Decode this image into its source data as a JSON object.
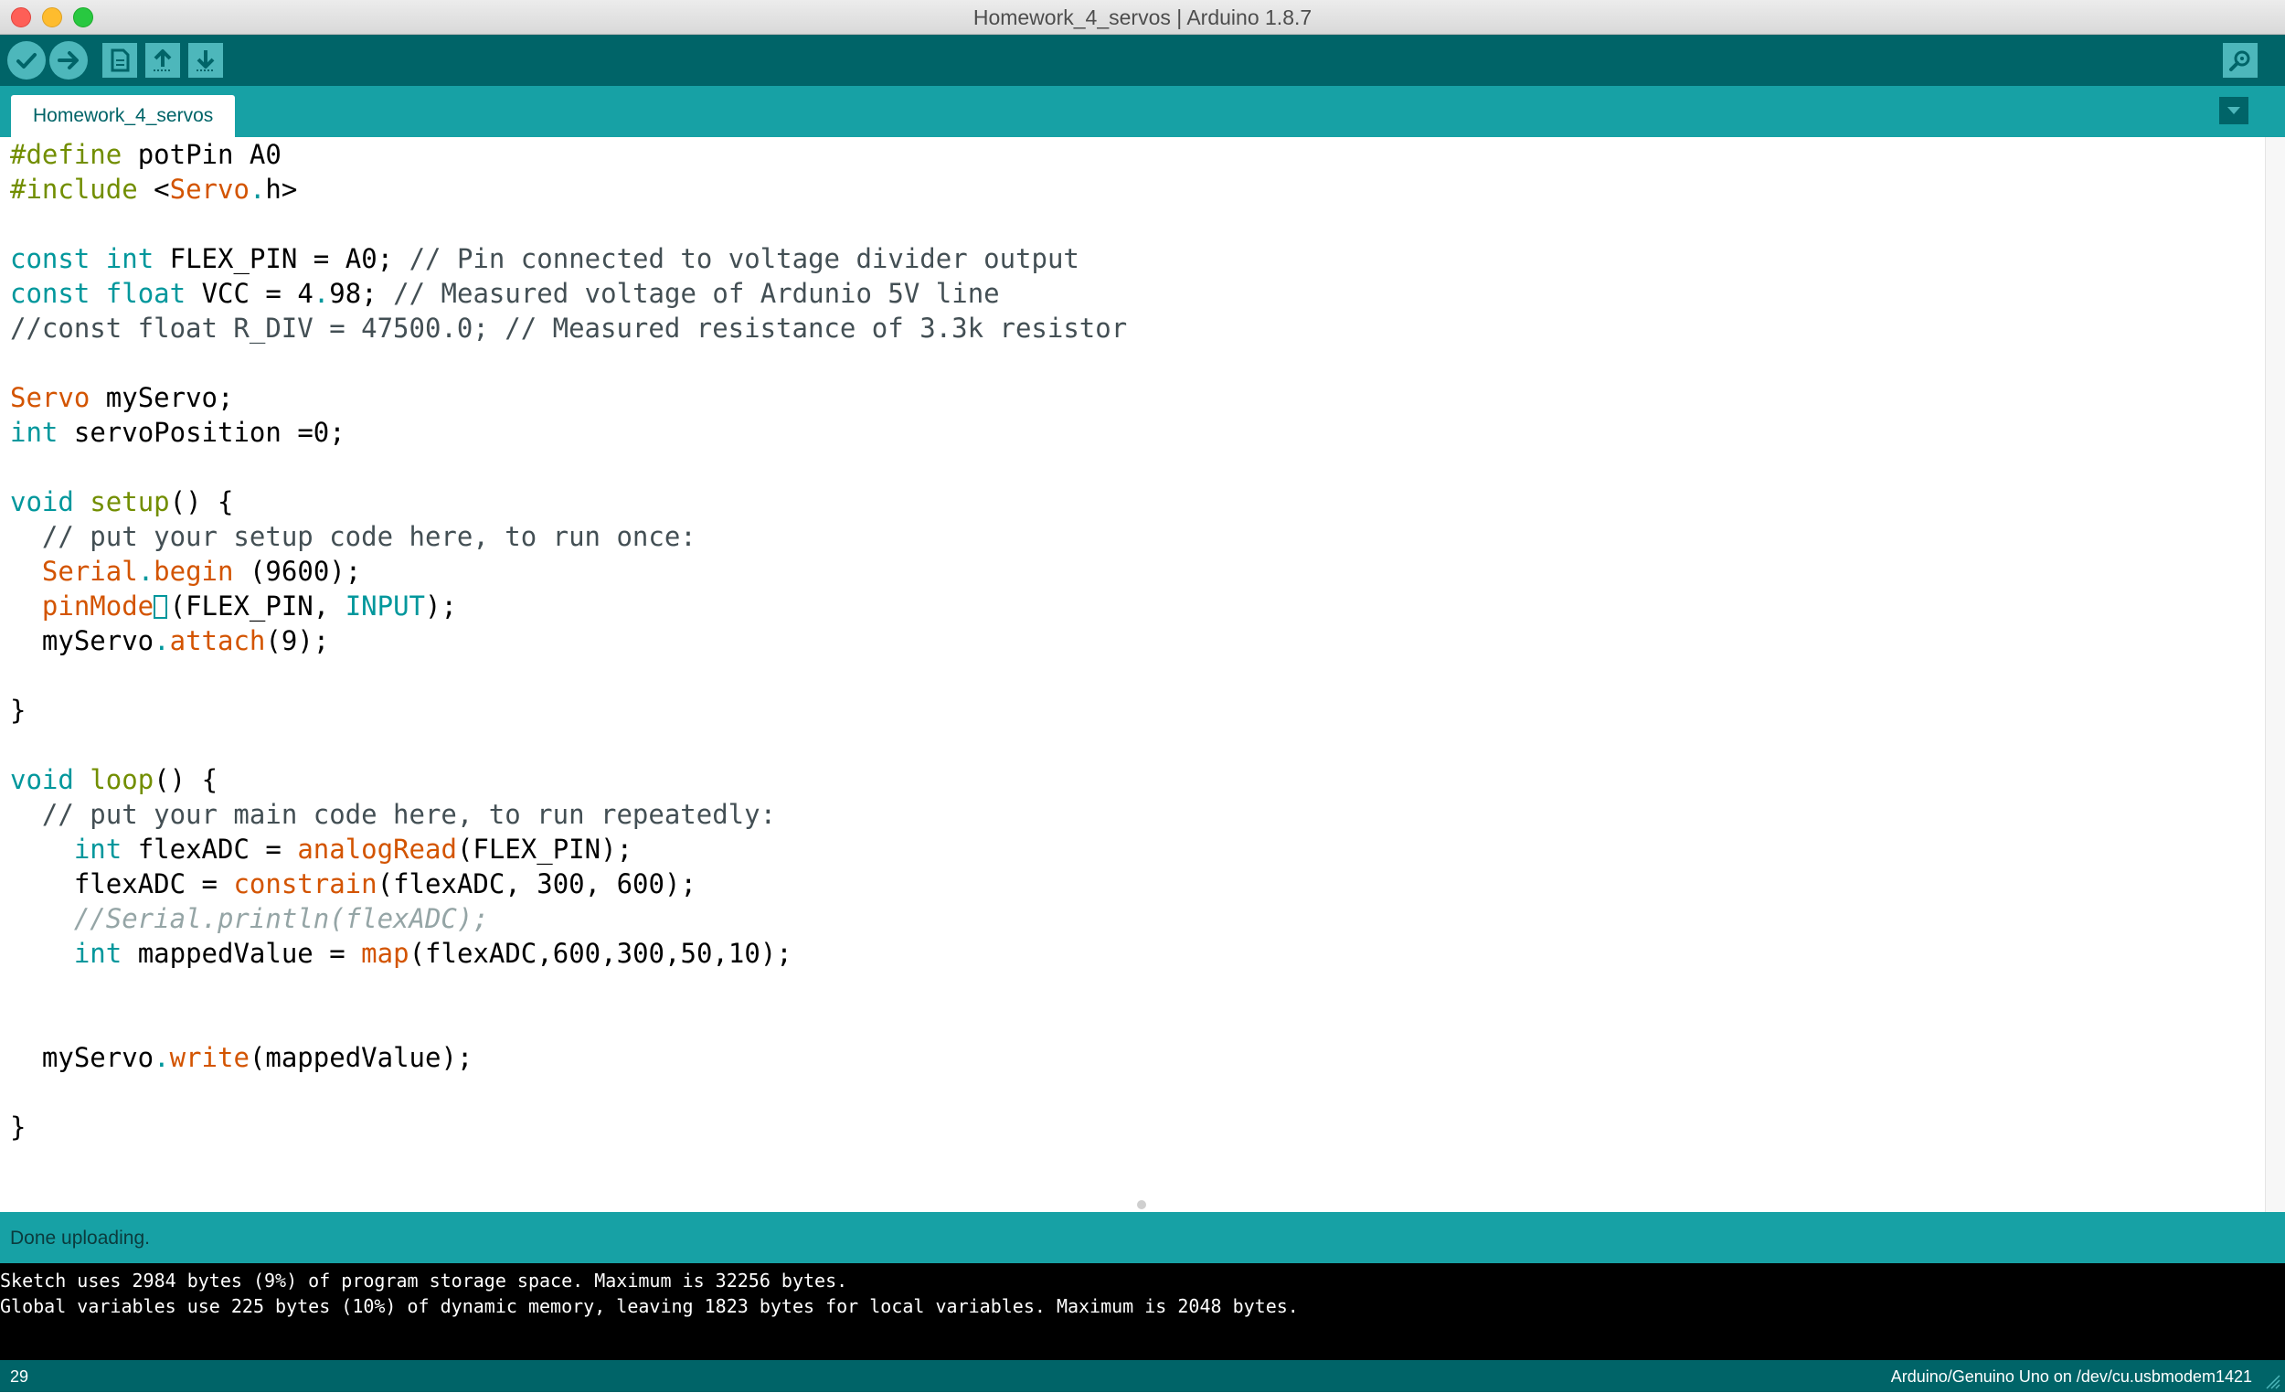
{
  "window": {
    "title": "Homework_4_servos | Arduino 1.8.7"
  },
  "toolbar": {
    "buttons": [
      {
        "name": "verify",
        "icon": "check-icon"
      },
      {
        "name": "upload",
        "icon": "arrow-right-icon"
      },
      {
        "name": "new",
        "icon": "document-icon"
      },
      {
        "name": "open",
        "icon": "arrow-up-icon"
      },
      {
        "name": "save",
        "icon": "arrow-down-icon"
      },
      {
        "name": "serial-monitor",
        "icon": "magnifier-icon"
      }
    ]
  },
  "tabs": {
    "active": "Homework_4_servos",
    "menu_icon": "triangle-down-icon"
  },
  "editor": {
    "lines": [
      "#define potPin A0",
      "#include <Servo.h>",
      "",
      "const int FLEX_PIN = A0; // Pin connected to voltage divider output",
      "const float VCC = 4.98; // Measured voltage of Ardunio 5V line",
      "//const float R_DIV = 47500.0; // Measured resistance of 3.3k resistor",
      "",
      "Servo myServo;",
      "int servoPosition =0;",
      "",
      "void setup() {",
      "  // put your setup code here, to run once:",
      "  Serial.begin (9600);",
      "  pinMode (FLEX_PIN, INPUT);",
      "  myServo.attach(9);",
      "",
      "}",
      "",
      "void loop() {",
      "  // put your main code here, to run repeatedly:",
      "    int flexADC = analogRead(FLEX_PIN);",
      "    flexADC = constrain(flexADC, 300, 600);",
      "    //Serial.println(flexADC);",
      "    int mappedValue = map(flexADC,600,300,50,10);",
      "",
      "",
      "  myServo.write(mappedValue);",
      "",
      "}"
    ]
  },
  "status": {
    "message": "Done uploading."
  },
  "console": {
    "lines": [
      "Sketch uses 2984 bytes (9%) of program storage space. Maximum is 32256 bytes.",
      "Global variables use 225 bytes (10%) of dynamic memory, leaving 1823 bytes for local variables. Maximum is 2048 bytes."
    ]
  },
  "footer": {
    "line_number": "29",
    "board": "Arduino/Genuino Uno on /dev/cu.usbmodem1421"
  },
  "colors": {
    "toolbar": "#006468",
    "tabbar": "#17a1a5",
    "keyword": "#00979c",
    "function": "#d35400",
    "type": "#728e00",
    "comment": "#434f54"
  }
}
